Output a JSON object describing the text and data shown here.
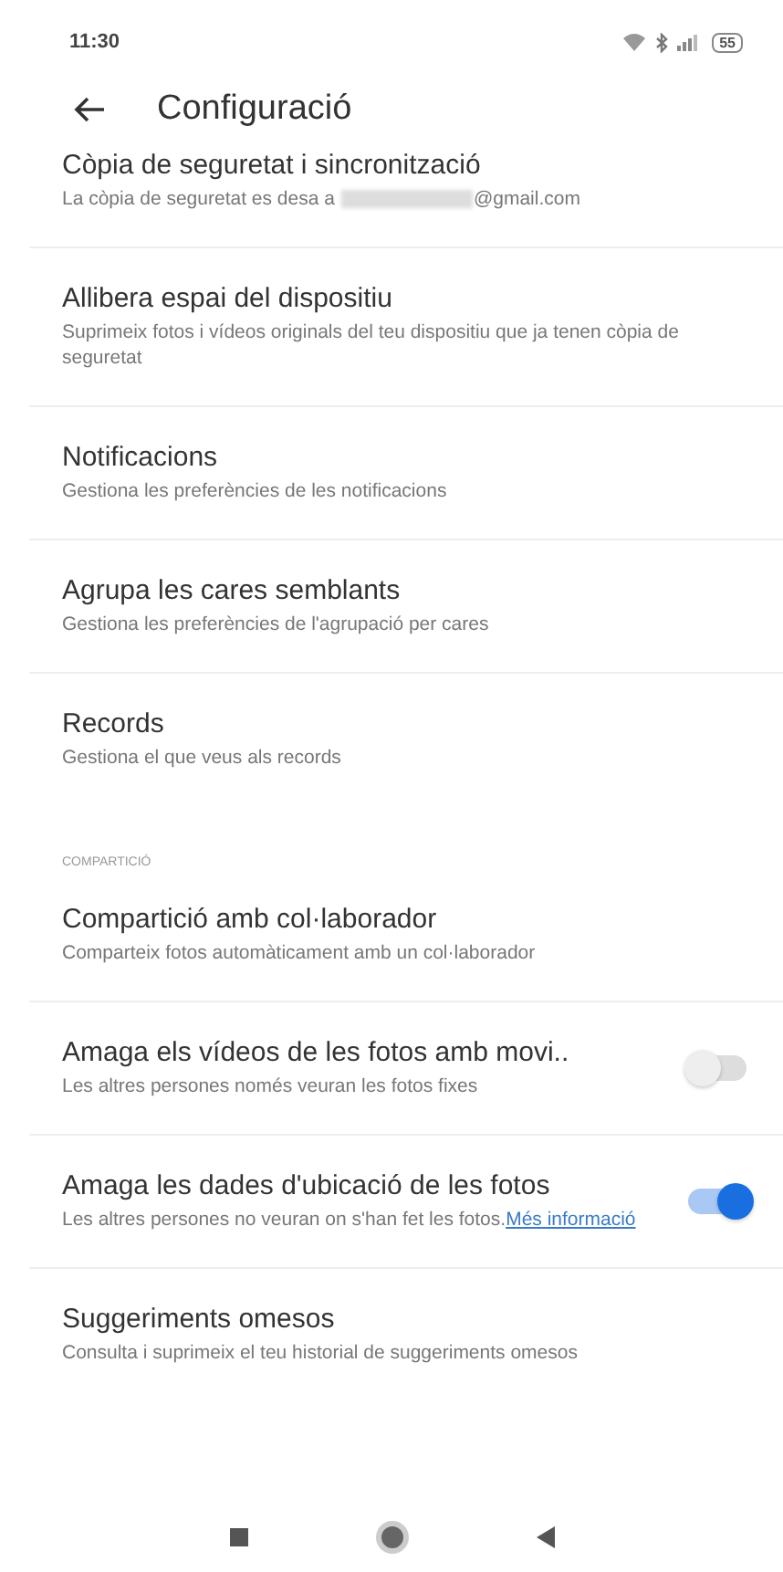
{
  "status_bar": {
    "time": "11:30",
    "battery": "55"
  },
  "header": {
    "title": "Configuració"
  },
  "sections": [
    {
      "items": [
        {
          "kind": "plain",
          "title": "Còpia de seguretat i sincronització",
          "subtitle": "La còpia de seguretat es desa a",
          "subtitle_end": "@gmail.com"
        },
        {
          "kind": "plain",
          "title": "Allibera espai del dispositiu",
          "subtitle": "Suprimeix fotos i vídeos originals del teu dispositiu que ja tenen còpia de seguretat"
        },
        {
          "kind": "plain",
          "title": "Notificacions",
          "subtitle": "Gestiona les preferències de les notificacions"
        },
        {
          "kind": "plain",
          "title": "Agrupa les cares semblants",
          "subtitle": "Gestiona les preferències de l'agrupació per cares"
        },
        {
          "kind": "plain",
          "title": "Records",
          "subtitle": "Gestiona el que veus als records"
        }
      ]
    },
    {
      "header": "COMPARTICIÓ",
      "items": [
        {
          "kind": "plain",
          "title": "Compartició amb col·laborador",
          "subtitle": "Comparteix fotos automàticament amb un col·laborador"
        },
        {
          "kind": "toggle",
          "on": false,
          "title": "Amaga els vídeos de les fotos amb movi..",
          "subtitle": "Les altres persones només veuran les fotos fixes"
        },
        {
          "kind": "toggle",
          "on": true,
          "title": "Amaga les dades d'ubicació de les fotos",
          "subtitle": "Les altres persones no veuran on s'han fet les fotos.",
          "link": "Més informació"
        },
        {
          "kind": "plain",
          "title": "Suggeriments omesos",
          "subtitle": "Consulta i suprimeix el teu historial de suggeriments omesos"
        }
      ]
    }
  ]
}
